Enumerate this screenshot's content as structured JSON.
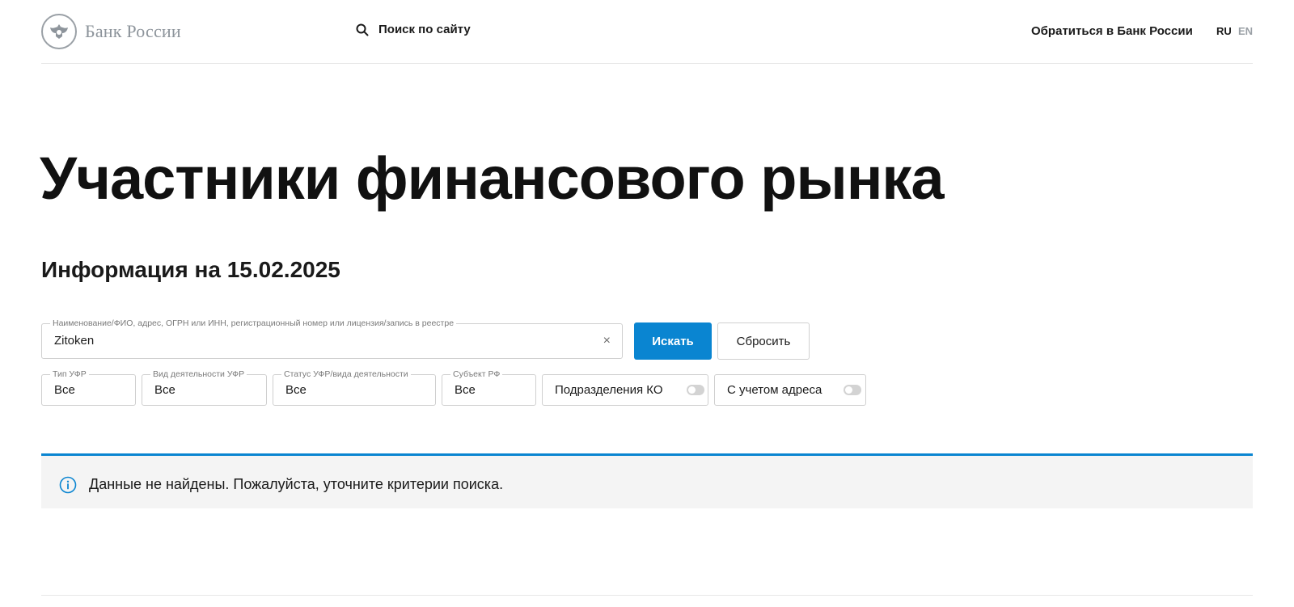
{
  "header": {
    "logo_text": "Банк России",
    "site_search_label": "Поиск по сайту",
    "contact_link": "Обратиться в Банк России",
    "lang_ru": "RU",
    "lang_en": "EN"
  },
  "main": {
    "title": "Участники финансового рынка",
    "info_date": "Информация на 15.02.2025"
  },
  "search": {
    "legend": "Наименование/ФИО, адрес, ОГРН или ИНН, регистрационный номер или лицензия/запись в реестре",
    "value": "Zitoken",
    "clear_icon": "×",
    "search_button": "Искать",
    "reset_button": "Сбросить"
  },
  "filters": {
    "type": {
      "legend": "Тип УФР",
      "value": "Все"
    },
    "activity": {
      "legend": "Вид деятельности УФР",
      "value": "Все"
    },
    "status": {
      "legend": "Статус УФР/вида деятельности",
      "value": "Все"
    },
    "region": {
      "legend": "Субъект РФ",
      "value": "Все"
    },
    "toggle_ko": {
      "label": "Подразделения КО",
      "enabled": false
    },
    "toggle_address": {
      "label": "С учетом адреса",
      "enabled": false
    }
  },
  "notice": {
    "text": "Данные не найдены. Пожалуйста, уточните критерии поиска.",
    "icon": "info-icon"
  },
  "colors": {
    "accent": "#0a85d1",
    "notice_bg": "#f4f4f4",
    "muted": "#9aa0a6"
  }
}
